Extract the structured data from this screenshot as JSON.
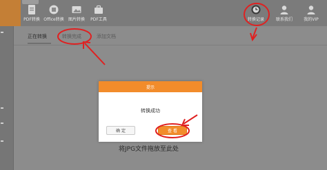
{
  "toolbar": {
    "items": [
      {
        "label": "PDF转换",
        "icon": "pdf-convert-icon"
      },
      {
        "label": "Office转换",
        "icon": "office-convert-icon"
      },
      {
        "label": "图片转换",
        "icon": "image-convert-icon"
      },
      {
        "label": "PDF工具",
        "icon": "pdf-tools-icon"
      },
      {
        "label": "转换记录",
        "icon": "history-clock-icon"
      },
      {
        "label": "联系我们",
        "icon": "contact-user-icon"
      },
      {
        "label": "我的VIP",
        "icon": "vip-user-icon"
      }
    ]
  },
  "tabs": [
    "正在转换",
    "转换完成",
    "添加文档"
  ],
  "drop_hint": "将JPG文件拖放至此处",
  "dialog": {
    "title": "提示",
    "message": "转换成功",
    "confirm_label": "确 定",
    "view_label": "查 看"
  },
  "colors": {
    "accent": "#f28c2b",
    "annotation": "#e02020",
    "overlay": "#8c8c8c"
  }
}
